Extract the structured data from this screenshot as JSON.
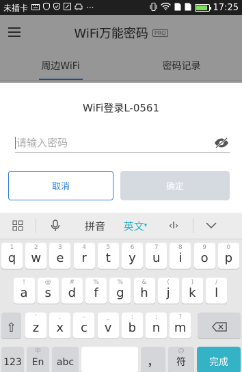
{
  "status_bar": {
    "carrier": "未插卡",
    "time": "17:25",
    "icons_left": [
      "keyboard-icon",
      "shield-icon",
      "shield-check-icon",
      "edit-icon",
      "car-icon",
      "more-icon"
    ],
    "icons_right": [
      "vibrate-icon",
      "wifi-icon",
      "sim1-icon",
      "sim2-icon",
      "battery-icon"
    ]
  },
  "app": {
    "title": "WiFi万能密码",
    "badge": "PRO",
    "tabs": [
      {
        "label": "周边WiFi",
        "active": true
      },
      {
        "label": "密码记录",
        "active": false
      }
    ]
  },
  "dialog": {
    "title": "WiFi登录L-0561",
    "password_placeholder": "请输入密码",
    "password_value": "",
    "cancel_label": "取消",
    "confirm_label": "确定",
    "accent_color": "#2d7fe0"
  },
  "keyboard": {
    "toolbar": {
      "pinyin": "拼音",
      "english": "英文",
      "cursor": "‹I›"
    },
    "row1": [
      {
        "main": "q",
        "sub": "1"
      },
      {
        "main": "w",
        "sub": "2"
      },
      {
        "main": "e",
        "sub": "3"
      },
      {
        "main": "r",
        "sub": "4"
      },
      {
        "main": "t",
        "sub": "5"
      },
      {
        "main": "y",
        "sub": "6"
      },
      {
        "main": "u",
        "sub": "7"
      },
      {
        "main": "i",
        "sub": "8"
      },
      {
        "main": "o",
        "sub": "9"
      },
      {
        "main": "p",
        "sub": "0"
      }
    ],
    "row2": [
      {
        "main": "a",
        "sub": "!"
      },
      {
        "main": "s",
        "sub": "@"
      },
      {
        "main": "d",
        "sub": "#"
      },
      {
        "main": "f",
        "sub": "%"
      },
      {
        "main": "g",
        "sub": "%"
      },
      {
        "main": "h",
        "sub": "&"
      },
      {
        "main": "j",
        "sub": "("
      },
      {
        "main": "k",
        "sub": ")"
      },
      {
        "main": "l",
        "sub": "/"
      }
    ],
    "row3": [
      {
        "main": "z",
        "sub": "'"
      },
      {
        "main": "x",
        "sub": ","
      },
      {
        "main": "c",
        "sub": "–"
      },
      {
        "main": "v",
        "sub": "_"
      },
      {
        "main": "b",
        "sub": ":"
      },
      {
        "main": "n",
        "sub": ";"
      },
      {
        "main": "m",
        "sub": "?"
      }
    ],
    "bottom": {
      "num": "123",
      "lang_sub": "中",
      "lang": "En",
      "abc": "abc",
      "comma": "，",
      "symbol_sub": "☺",
      "symbol": "符",
      "done": "完成"
    },
    "done_color": "#34b3c7"
  }
}
